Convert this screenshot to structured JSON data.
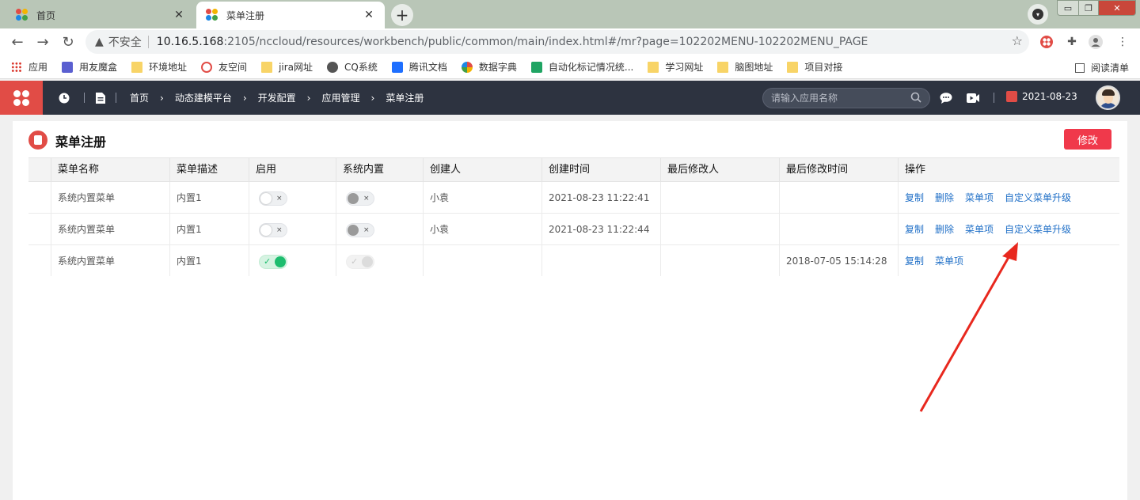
{
  "browser": {
    "tabs": [
      {
        "title": "首页",
        "active": false
      },
      {
        "title": "菜单注册",
        "active": true
      }
    ],
    "new_tab": "+",
    "window_controls": {
      "minimize": "▭",
      "maximize": "❐",
      "close": "✕"
    },
    "address": {
      "security": "不安全",
      "host": "10.16.5.168",
      "path": ":2105/nccloud/resources/workbench/public/common/main/index.html#/mr?page=102202MENU-102202MENU_PAGE"
    },
    "bookmarks": [
      {
        "label": "应用",
        "icon": "apps-grid-icon",
        "color": "#d93025"
      },
      {
        "label": "用友魔盒",
        "icon": "box-icon",
        "color": "#5a5fd0"
      },
      {
        "label": "环境地址",
        "icon": "folder-icon",
        "color": "#f8d467"
      },
      {
        "label": "友空间",
        "icon": "yonyou-space-icon",
        "color": "#e14c46"
      },
      {
        "label": "jira网址",
        "icon": "folder-icon",
        "color": "#f8d467"
      },
      {
        "label": "CQ系统",
        "icon": "globe-icon",
        "color": "#555555"
      },
      {
        "label": "腾讯文档",
        "icon": "tencent-docs-icon",
        "color": "#1e6fff"
      },
      {
        "label": "数据字典",
        "icon": "yonyou-logo-icon",
        "color": "#e14c46"
      },
      {
        "label": "自动化标记情况统...",
        "icon": "sheet-icon",
        "color": "#1fa463"
      },
      {
        "label": "学习网址",
        "icon": "folder-icon",
        "color": "#f8d467"
      },
      {
        "label": "脑图地址",
        "icon": "folder-icon",
        "color": "#f8d467"
      },
      {
        "label": "项目对接",
        "icon": "folder-icon",
        "color": "#f8d467"
      }
    ],
    "reading_list": "阅读清单"
  },
  "app": {
    "breadcrumbs": [
      "首页",
      "动态建模平台",
      "开发配置",
      "应用管理",
      "菜单注册"
    ],
    "search_placeholder": "请输入应用名称",
    "date": "2021-08-23",
    "accent_color": "#e14c46"
  },
  "page": {
    "title": "菜单注册",
    "edit_button": "修改"
  },
  "table": {
    "columns": [
      "菜单名称",
      "菜单描述",
      "启用",
      "系统内置",
      "创建人",
      "创建时间",
      "最后修改人",
      "最后修改时间",
      "操作"
    ],
    "rows": [
      {
        "name": "系统内置菜单",
        "desc": "内置1",
        "enabled": false,
        "builtin": false,
        "creator": "小袁",
        "created": "2021-08-23 11:22:41",
        "modifier": "",
        "modified": "",
        "actions": [
          "复制",
          "删除",
          "菜单项",
          "自定义菜单升级"
        ]
      },
      {
        "name": "系统内置菜单",
        "desc": "内置1",
        "enabled": false,
        "builtin": false,
        "creator": "小袁",
        "created": "2021-08-23 11:22:44",
        "modifier": "",
        "modified": "",
        "actions": [
          "复制",
          "删除",
          "菜单项",
          "自定义菜单升级"
        ]
      },
      {
        "name": "系统内置菜单",
        "desc": "内置1",
        "enabled": true,
        "builtin": true,
        "creator": "",
        "created": "",
        "modifier": "",
        "modified": "2018-07-05 15:14:28",
        "actions": [
          "复制",
          "菜单项"
        ]
      }
    ],
    "switch_on_mark": "✓",
    "switch_off_mark": "×"
  },
  "annotation": {
    "color": "#e8281e"
  }
}
